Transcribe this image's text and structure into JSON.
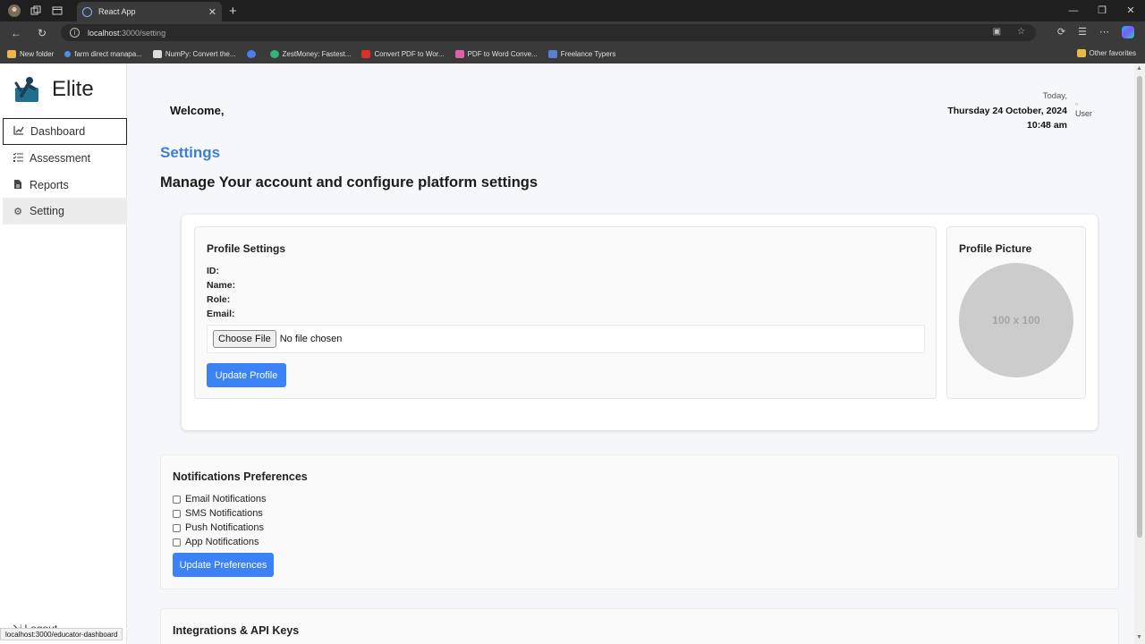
{
  "browser": {
    "tab_title": "React App",
    "url_host": "localhost",
    "url_path": ":3000/setting",
    "status_url": "localhost:3000/educator-dashboard",
    "bookmarks": [
      {
        "label": "New folder",
        "color": "#e8b84a"
      },
      {
        "label": "farm direct manapa...",
        "color": "#4a8df0"
      },
      {
        "label": "NumPy: Convert the...",
        "color": "#dddddd"
      },
      {
        "label": "",
        "color": "#4a7df0"
      },
      {
        "label": "ZestMoney: Fastest...",
        "color": "#2fb57a"
      },
      {
        "label": "Convert PDF to Wor...",
        "color": "#d9302c"
      },
      {
        "label": "PDF to Word Conve...",
        "color": "#e05fa8"
      },
      {
        "label": "Freelance Typers",
        "color": "#5b7fd0"
      }
    ],
    "other_favorites": "Other favorites"
  },
  "sidebar": {
    "brand": "Elite",
    "items": [
      {
        "label": "Dashboard",
        "icon": "chart-line-icon"
      },
      {
        "label": "Assessment",
        "icon": "list-check-icon"
      },
      {
        "label": "Reports",
        "icon": "file-icon"
      },
      {
        "label": "Setting",
        "icon": "gear-icon"
      }
    ],
    "logout": "Logout"
  },
  "header": {
    "welcome": "Welcome,",
    "today": "Today,",
    "date": "Thursday 24 October, 2024",
    "time": "10:48 am",
    "avatar_alt": "User"
  },
  "main": {
    "title": "Settings",
    "subtitle": "Manage Your account and configure platform settings"
  },
  "profile": {
    "title": "Profile Settings",
    "id_label": "ID:",
    "name_label": "Name:",
    "role_label": "Role:",
    "email_label": "Email:",
    "file_button": "Choose File",
    "file_status": "No file chosen",
    "update_button": "Update Profile"
  },
  "picture": {
    "title": "Profile Picture",
    "placeholder": "100 x 100"
  },
  "notifications": {
    "title": "Notifications Preferences",
    "options": [
      "Email Notifications",
      "SMS Notifications",
      "Push Notifications",
      "App Notifications"
    ],
    "update_button": "Update Preferences"
  },
  "integrations": {
    "title": "Integrations & API Keys"
  },
  "colors": {
    "accent": "#3b82f6",
    "title_blue": "#3b7fd9"
  }
}
